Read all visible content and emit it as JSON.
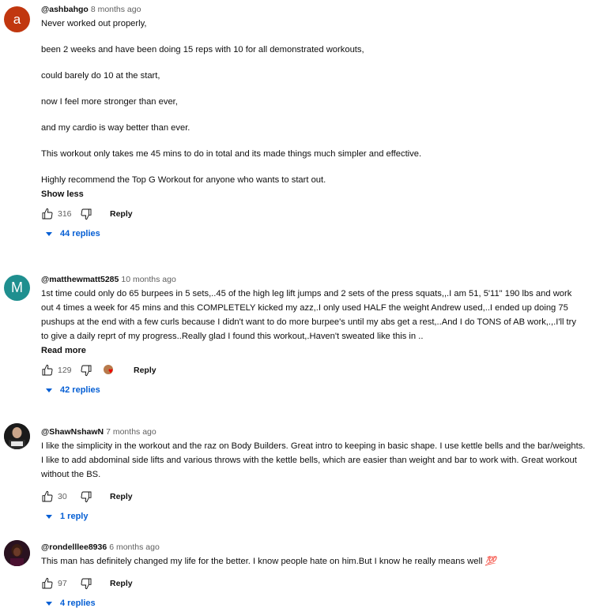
{
  "comments": [
    {
      "avatar_letter": "a",
      "handle": "@ashbahgo",
      "time": "8 months ago",
      "paragraphs": [
        "Never worked out properly,",
        "been 2 weeks and have been doing 15 reps with 10 for all demonstrated workouts,",
        "could barely do 10 at the start,",
        "now I feel more stronger than ever,",
        "and my cardio is way better than ever.",
        "This workout only takes me 45 mins to do in total and its made things much simpler and effective.",
        "Highly recommend the Top G Workout for anyone who wants to start out."
      ],
      "toggle": "Show less",
      "likes": "316",
      "reply_label": "Reply",
      "replies": "44 replies"
    },
    {
      "avatar_letter": "M",
      "handle": "@matthewmatt5285",
      "time": "10 months ago",
      "text": "1st time could  only do 65 burpees in 5 sets,..45 of the high leg lift jumps and 2 sets of the press squats,,.I am 51,  5'11\" 190 lbs and work out 4 times a week for 45 mins and this COMPLETELY kicked my azz,.I only used HALF the weight Andrew used,..I ended up doing 75 pushups at the end with a few curls because I didn't want to do more burpee's until my abs get a rest,..And I do TONS of AB work,.,.I'll try to give a daily reprt of my progress..Really glad I found this workout,.Haven't sweated like this in ..",
      "toggle": "Read more",
      "likes": "129",
      "reply_label": "Reply",
      "replies": "42 replies"
    },
    {
      "handle": "@ShawNshawN",
      "time": "7 months ago",
      "text": "I like the simplicity in the workout and the raz on Body Builders. Great intro to keeping in basic shape. I use kettle bells and the bar/weights.  I like to add abdominal side lifts and various throws with the kettle bells, which are easier than weight and bar to work with.  Great workout without the BS.",
      "likes": "30",
      "reply_label": "Reply",
      "replies": "1 reply"
    },
    {
      "handle": "@rondelllee8936",
      "time": "6 months ago",
      "text": "This man has definitely changed my life for the better. I know people hate on him.But I know he really means well",
      "emoji": "💯",
      "likes": "97",
      "reply_label": "Reply",
      "replies": "4 replies"
    }
  ],
  "colors": {
    "link": "#065fd4",
    "muted": "#606060",
    "avatar_a": "#c1370f",
    "avatar_m": "#1f8f8f"
  }
}
